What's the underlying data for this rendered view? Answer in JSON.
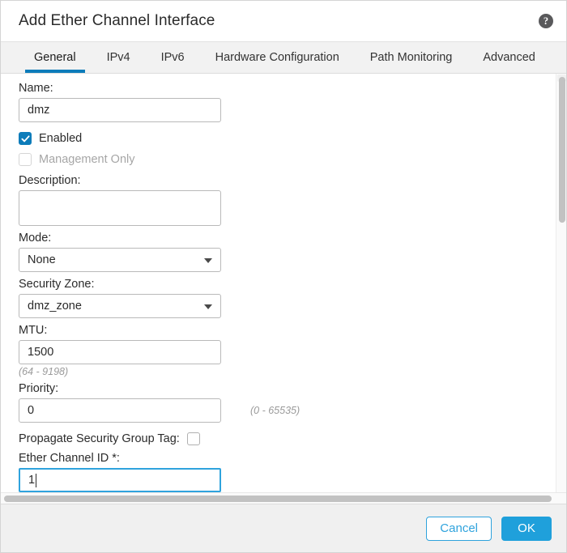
{
  "dialog": {
    "title": "Add Ether Channel Interface",
    "help_icon": "help-circle-icon"
  },
  "tabs": [
    {
      "label": "General",
      "active": true
    },
    {
      "label": "IPv4",
      "active": false
    },
    {
      "label": "IPv6",
      "active": false
    },
    {
      "label": "Hardware Configuration",
      "active": false
    },
    {
      "label": "Path Monitoring",
      "active": false
    },
    {
      "label": "Advanced",
      "active": false
    }
  ],
  "form": {
    "name": {
      "label": "Name:",
      "value": "dmz",
      "placeholder": ""
    },
    "enabled": {
      "label": "Enabled",
      "checked": true
    },
    "management_only": {
      "label": "Management Only",
      "checked": false,
      "disabled": true
    },
    "description": {
      "label": "Description:",
      "value": "",
      "placeholder": ""
    },
    "mode": {
      "label": "Mode:",
      "value": "None"
    },
    "security_zone": {
      "label": "Security Zone:",
      "value": "dmz_zone"
    },
    "mtu": {
      "label": "MTU:",
      "value": "1500",
      "hint": "(64 - 9198)"
    },
    "priority": {
      "label": "Priority:",
      "value": "0",
      "hint": "(0 - 65535)"
    },
    "propagate_sgt": {
      "label": "Propagate Security Group Tag:",
      "checked": false
    },
    "ether_channel_id": {
      "label": "Ether Channel ID *:",
      "value": "1",
      "focused": true
    }
  },
  "footer": {
    "cancel_label": "Cancel",
    "ok_label": "OK"
  },
  "colors": {
    "accent": "#0c7cba",
    "ok_button": "#1fa0db",
    "cancel_border": "#2fa3dd",
    "focus_border": "#2fa3dd",
    "checkbox_checked": "#0d7cba",
    "hint_text": "#9a9a9a"
  }
}
